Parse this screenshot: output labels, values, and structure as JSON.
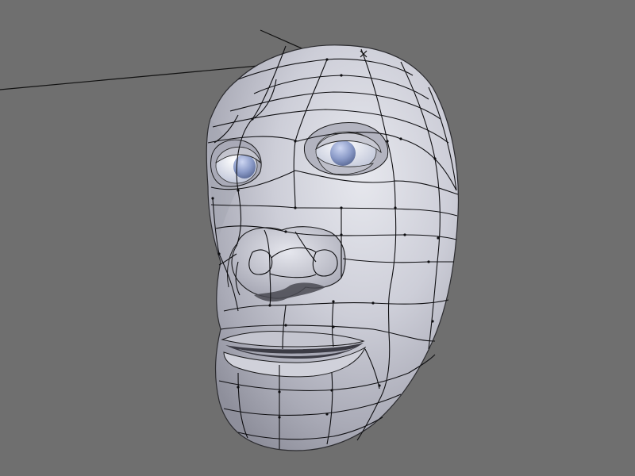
{
  "viewport": {
    "background_color": "#6f6f6f",
    "shading_mode": "solid-subsurf",
    "selected_object": "head-mesh"
  },
  "object": {
    "name_icon": "mesh-head",
    "surface_color": "#c9c9d3",
    "wire_color": "#101010",
    "eye_iris_color": "#8b9bc8",
    "eye_white_color": "#e4e7f2"
  },
  "scene": {
    "lamp_icon": "lamp-lines",
    "cursor_icon": "3d-cursor-cross"
  }
}
